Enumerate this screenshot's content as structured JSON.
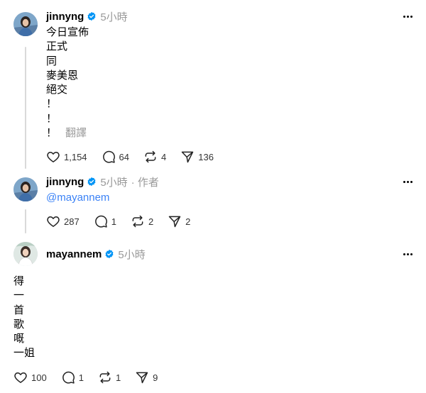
{
  "posts": [
    {
      "username": "jinnyng",
      "time": "5小時",
      "lines": [
        "今日宣佈",
        "正式",
        "同",
        "麥美恩",
        "絕交",
        "！",
        "！",
        "！"
      ],
      "translate": "翻譯",
      "counts": {
        "likes": "1,154",
        "replies": "64",
        "reposts": "4",
        "shares": "136"
      }
    },
    {
      "username": "jinnyng",
      "time": "5小時",
      "author_tag": "· 作者",
      "mention": "@mayannem",
      "counts": {
        "likes": "287",
        "replies": "1",
        "reposts": "2",
        "shares": "2"
      }
    },
    {
      "username": "mayannem",
      "time": "5小時",
      "lines": [
        "得",
        "一",
        "首",
        "歌",
        "嘅",
        "一姐"
      ],
      "counts": {
        "likes": "100",
        "replies": "1",
        "reposts": "1",
        "shares": "9"
      }
    }
  ],
  "icons": {
    "verified": "verified-badge-icon",
    "more": "more-horizontal-icon",
    "like": "heart-icon",
    "reply": "comment-icon",
    "repost": "repost-icon",
    "share": "send-icon"
  },
  "colors": {
    "verified": "#0095f6",
    "mention": "#3b82f6",
    "muted": "#999999"
  }
}
